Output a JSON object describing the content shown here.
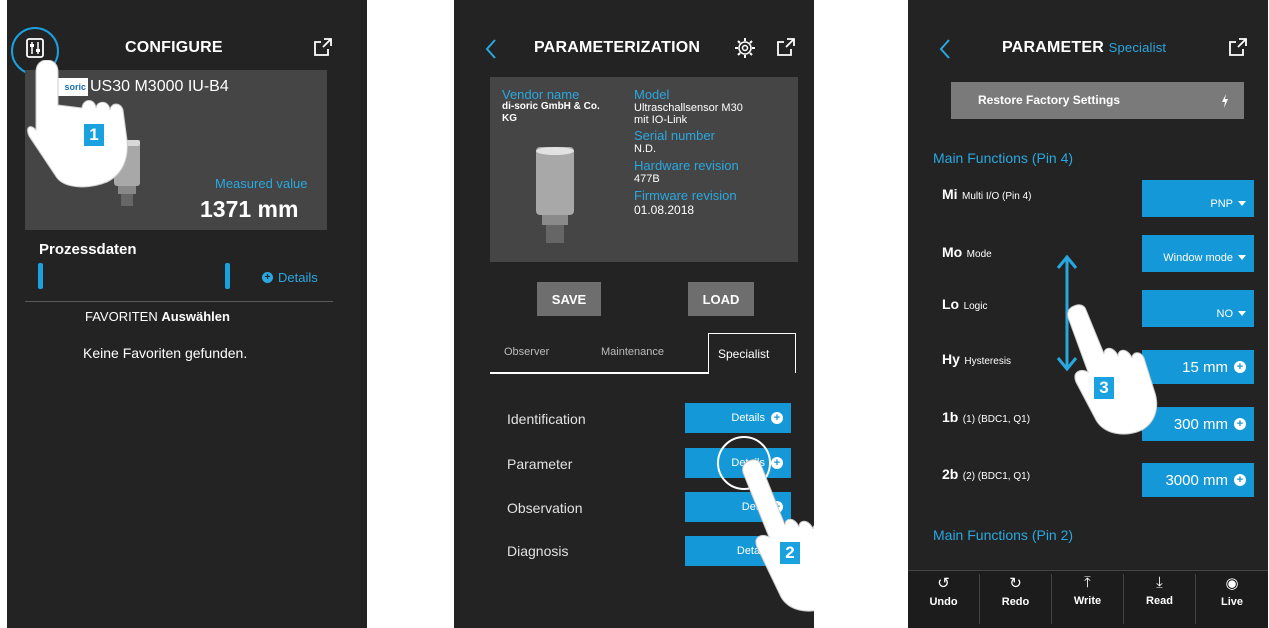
{
  "colors": {
    "background": "#232323",
    "accent": "#29a8e0",
    "button_blue": "#1598d7",
    "panel": "#454545",
    "button_grey": "#6e6e6e"
  },
  "screen1": {
    "title": "CONFIGURE",
    "logo_text": "soric",
    "device_name": "US30 M3000 IU-B4",
    "measured_label": "Measured value",
    "measured_value": "1371 mm",
    "process_label": "Prozessdaten",
    "details_label": "Details",
    "favorites_prefix": "FAVORITEN",
    "favorites_action": "Auswählen",
    "no_favorites": "Keine Favoriten gefunden.",
    "step": "1",
    "icons": [
      "settings-sliders-icon",
      "share-icon",
      "details-plus-icon"
    ]
  },
  "screen2": {
    "title": "PARAMETERIZATION",
    "vendor_label": "Vendor name",
    "vendor_value_1": "di-soric GmbH & Co.",
    "vendor_value_2": "KG",
    "model_label": "Model",
    "model_value_1": "Ultraschallsensor M30",
    "model_value_2": "mit IO-Link",
    "serial_label": "Serial number",
    "serial_value": "N.D.",
    "hw_label": "Hardware revision",
    "hw_value": "477B",
    "fw_label": "Firmware revision",
    "fw_value": "01.08.2018",
    "save_label": "SAVE",
    "load_label": "LOAD",
    "tabs": [
      {
        "label": "Observer"
      },
      {
        "label": "Maintenance"
      },
      {
        "label": "Specialist"
      }
    ],
    "rows": [
      {
        "label": "Identification",
        "button": "Details"
      },
      {
        "label": "Parameter",
        "button": "Details"
      },
      {
        "label": "Observation",
        "button": "Deta"
      },
      {
        "label": "Diagnosis",
        "button": "Detail"
      }
    ],
    "step": "2",
    "icons": [
      "back-icon",
      "gear-icon",
      "share-icon"
    ]
  },
  "screen3": {
    "title_main": "PARAMETER",
    "title_sub": "Specialist",
    "restore_label": "Restore Factory Settings",
    "section1": "Main Functions (Pin 4)",
    "section2": "Main Functions (Pin 2)",
    "params": [
      {
        "code": "Mi",
        "name": "Multi I/O (Pin 4)",
        "value": "PNP",
        "kind": "select"
      },
      {
        "code": "Mo",
        "name": "Mode",
        "value": "Window mode",
        "kind": "select"
      },
      {
        "code": "Lo",
        "name": "Logic",
        "value": "NO",
        "kind": "select"
      },
      {
        "code": "Hy",
        "name": "Hysteresis",
        "value": "15 mm",
        "kind": "number"
      },
      {
        "code": "1b",
        "name": "(1) (BDC1, Q1)",
        "value": "300 mm",
        "kind": "number"
      },
      {
        "code": "2b",
        "name": "(2) (BDC1, Q1)",
        "value": "3000 mm",
        "kind": "number"
      }
    ],
    "toolbar": [
      {
        "label": "Undo",
        "icon": "undo-icon"
      },
      {
        "label": "Redo",
        "icon": "redo-icon"
      },
      {
        "label": "Write",
        "icon": "write-icon"
      },
      {
        "label": "Read",
        "icon": "read-icon"
      },
      {
        "label": "Live",
        "icon": "live-icon"
      }
    ],
    "step": "3"
  }
}
